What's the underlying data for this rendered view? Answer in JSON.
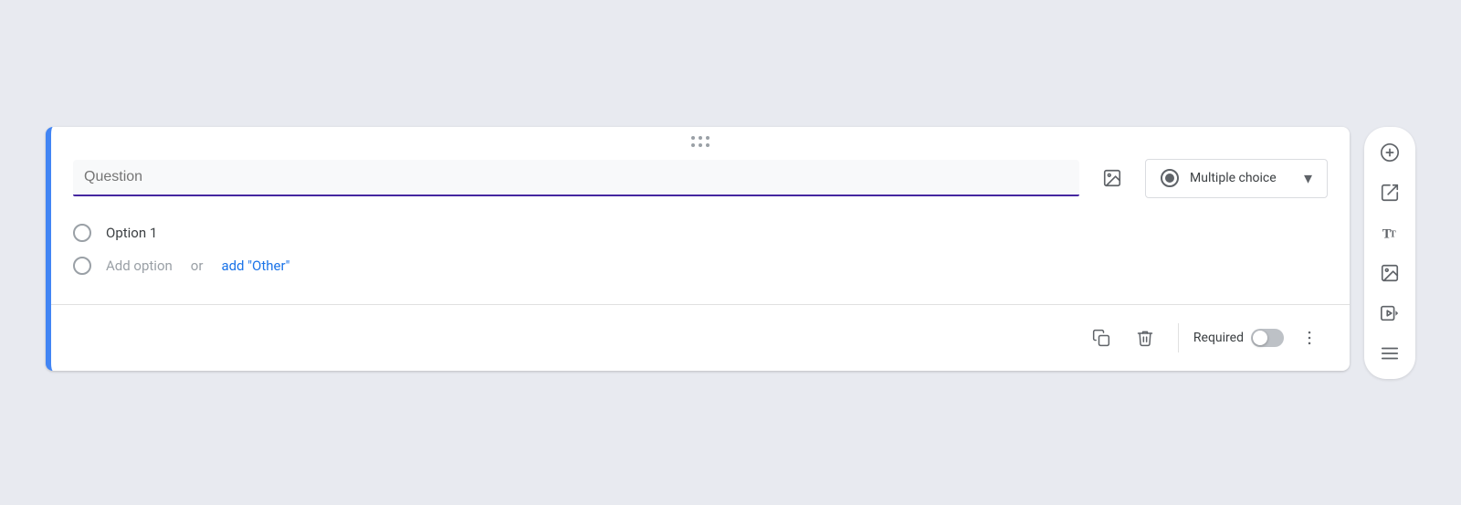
{
  "card": {
    "question_placeholder": "Question",
    "question_type": "Multiple choice",
    "option1_label": "Option 1",
    "add_option_text": "Add option",
    "add_option_or": "or",
    "add_other_text": "add \"Other\"",
    "required_label": "Required",
    "footer": {
      "copy_title": "Duplicate",
      "delete_title": "Delete",
      "more_title": "More options"
    }
  },
  "sidebar": {
    "add_question_title": "Add question",
    "import_question_title": "Import questions",
    "add_title_title": "Add title and description",
    "add_image_title": "Add image",
    "add_video_title": "Add video",
    "add_section_title": "Add section"
  },
  "colors": {
    "accent_blue": "#4285f4",
    "active_underline": "#4527a0",
    "link_blue": "#1a73e8"
  }
}
